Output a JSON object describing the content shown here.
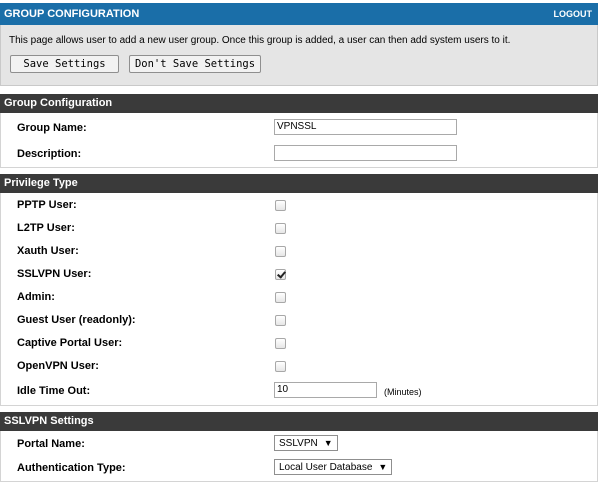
{
  "header": {
    "title": "GROUP CONFIGURATION",
    "logout": "LOGOUT"
  },
  "intro": {
    "text": "This page allows user to add a new user group. Once this group is added, a user can then add system users to it.",
    "save_label": "Save Settings",
    "dont_save_label": "Don't Save Settings"
  },
  "group_config": {
    "heading": "Group Configuration",
    "group_name_label": "Group Name:",
    "group_name_value": "VPNSSL",
    "description_label": "Description:",
    "description_value": ""
  },
  "privilege": {
    "heading": "Privilege Type",
    "items": [
      {
        "label": "PPTP User:",
        "checked": false
      },
      {
        "label": "L2TP User:",
        "checked": false
      },
      {
        "label": "Xauth User:",
        "checked": false
      },
      {
        "label": "SSLVPN User:",
        "checked": true
      },
      {
        "label": "Admin:",
        "checked": false
      },
      {
        "label": "Guest User (readonly):",
        "checked": false
      },
      {
        "label": "Captive Portal User:",
        "checked": false
      },
      {
        "label": "OpenVPN User:",
        "checked": false
      }
    ],
    "idle_label": "Idle Time Out:",
    "idle_value": "10",
    "idle_unit": "(Minutes)"
  },
  "sslvpn": {
    "heading": "SSLVPN Settings",
    "portal_label": "Portal Name:",
    "portal_value": "SSLVPN",
    "auth_label": "Authentication Type:",
    "auth_value": "Local User Database"
  }
}
